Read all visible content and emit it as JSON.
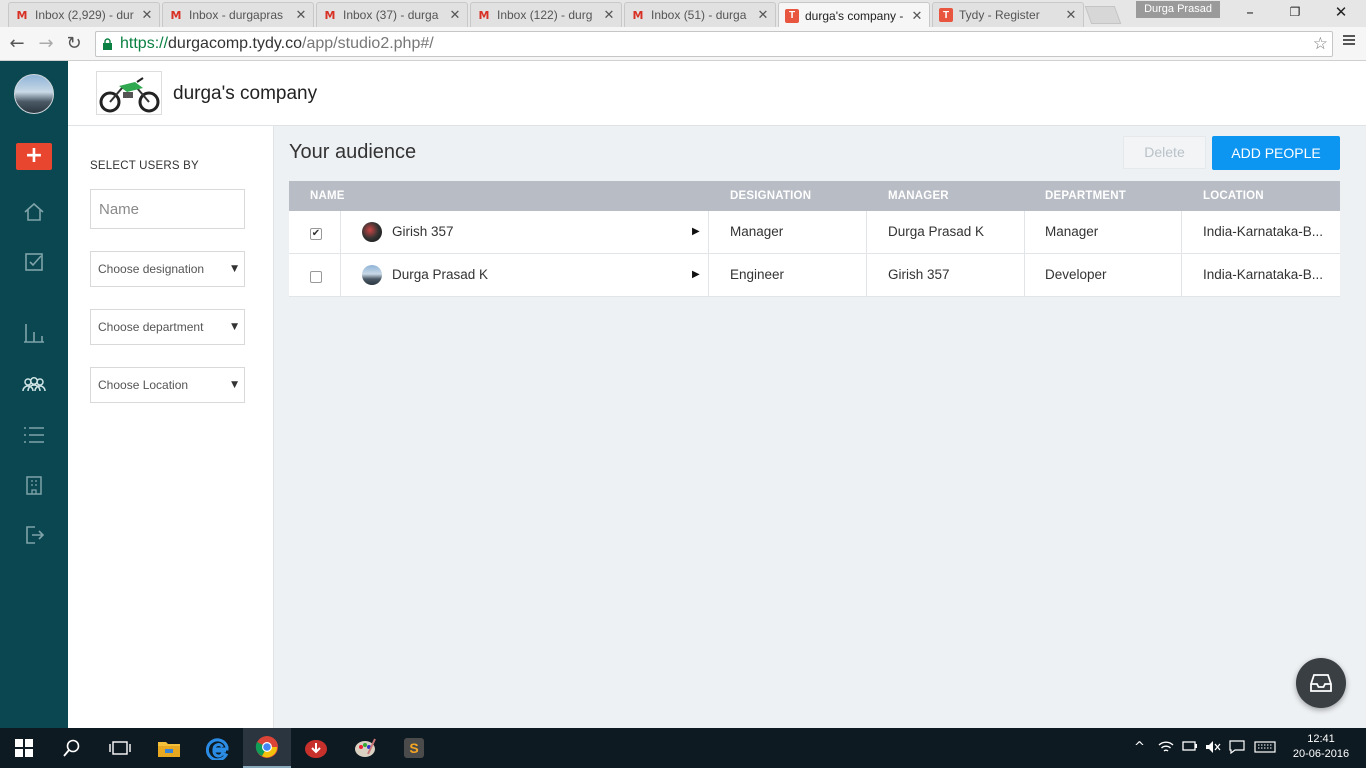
{
  "browser": {
    "tabs": [
      {
        "label": "Inbox (2,929) - dur",
        "icon": "gmail-icon",
        "active": false
      },
      {
        "label": "Inbox - durgapras",
        "icon": "gmail-icon",
        "active": false
      },
      {
        "label": "Inbox (37) - durga",
        "icon": "gmail-icon",
        "active": false
      },
      {
        "label": "Inbox (122) - durg",
        "icon": "gmail-icon",
        "active": false
      },
      {
        "label": "Inbox (51) - durga",
        "icon": "gmail-icon",
        "active": false
      },
      {
        "label": "durga's company -",
        "icon": "tydy-icon",
        "active": true
      },
      {
        "label": "Tydy - Register",
        "icon": "tydy-icon",
        "active": false
      }
    ],
    "profile_name": "Durga Prasad",
    "url": {
      "scheme": "https://",
      "host": "durgacomp.tydy.co",
      "path": "/app/studio2.php#/"
    }
  },
  "company": {
    "name": "durga's company"
  },
  "sidebar": {
    "add_label": "+",
    "items": [
      {
        "name": "home-icon"
      },
      {
        "name": "tasks-icon"
      },
      {
        "name": "analytics-icon"
      },
      {
        "name": "people-icon"
      },
      {
        "name": "list-icon"
      },
      {
        "name": "building-icon"
      },
      {
        "name": "logout-icon"
      }
    ]
  },
  "filters": {
    "title": "SELECT USERS BY",
    "name_placeholder": "Name",
    "designation": "Choose designation",
    "department": "Choose department",
    "location": "Choose Location"
  },
  "main": {
    "title": "Your audience",
    "delete_label": "Delete",
    "add_people_label": "ADD PEOPLE",
    "columns": [
      "NAME",
      "DESIGNATION",
      "MANAGER",
      "DEPARTMENT",
      "LOCATION"
    ],
    "rows": [
      {
        "checked": true,
        "name": "Girish 357",
        "designation": "Manager",
        "manager": "Durga Prasad K",
        "department": "Manager",
        "location": "India-Karnataka-B..."
      },
      {
        "checked": false,
        "name": "Durga Prasad K",
        "designation": "Engineer",
        "manager": "Girish 357",
        "department": "Developer",
        "location": "India-Karnataka-B..."
      }
    ]
  },
  "taskbar": {
    "time": "12:41",
    "date": "20-06-2016"
  },
  "colors": {
    "sidebar_bg": "#0a4750",
    "add_button": "#e8462f",
    "primary_button": "#0d95f2",
    "table_header": "#b8bcc4"
  }
}
